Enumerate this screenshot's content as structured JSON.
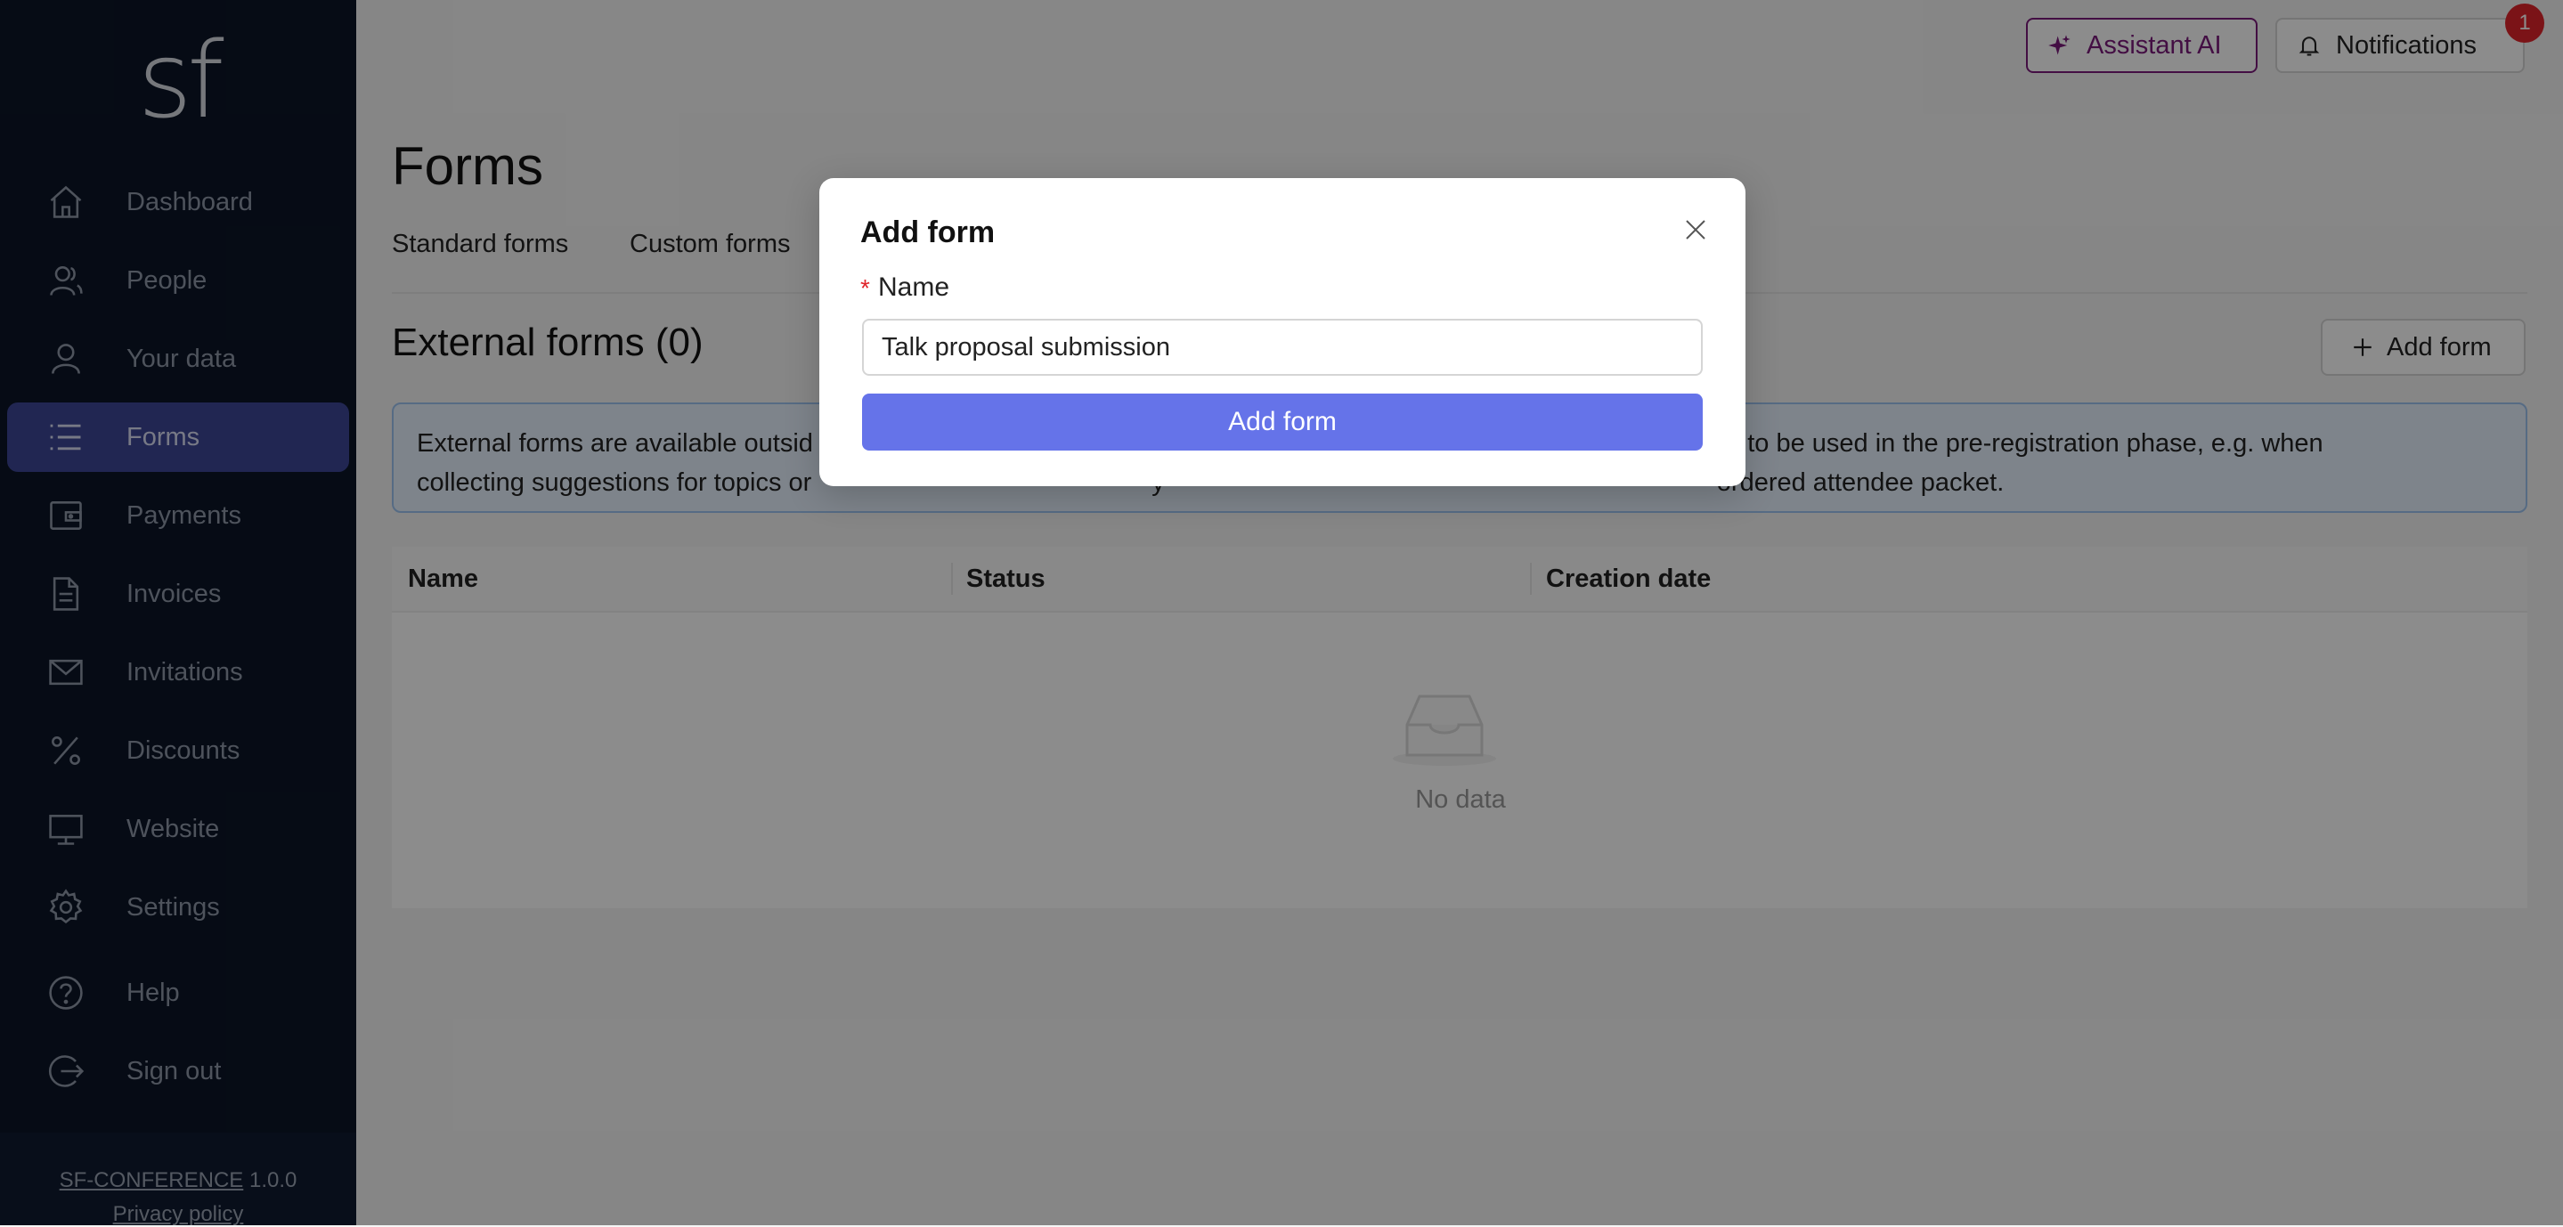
{
  "sidebar": {
    "logo": "sf",
    "items": [
      {
        "label": "Dashboard",
        "icon": "home-icon",
        "active": false
      },
      {
        "label": "People",
        "icon": "people-icon",
        "active": false
      },
      {
        "label": "Your data",
        "icon": "user-icon",
        "active": false
      },
      {
        "label": "Forms",
        "icon": "list-icon",
        "active": true
      },
      {
        "label": "Payments",
        "icon": "wallet-icon",
        "active": false
      },
      {
        "label": "Invoices",
        "icon": "document-icon",
        "active": false
      },
      {
        "label": "Invitations",
        "icon": "mail-icon",
        "active": false
      },
      {
        "label": "Discounts",
        "icon": "percent-icon",
        "active": false
      },
      {
        "label": "Website",
        "icon": "desktop-icon",
        "active": false
      },
      {
        "label": "Settings",
        "icon": "gear-icon",
        "active": false
      },
      {
        "label": "Help",
        "icon": "help-icon",
        "active": false
      },
      {
        "label": "Sign out",
        "icon": "logout-icon",
        "active": false
      }
    ],
    "footer": {
      "app_name": "SF-CONFERENCE",
      "version": "1.0.0",
      "privacy": "Privacy policy"
    }
  },
  "header": {
    "assistant_label": "Assistant AI",
    "notifications_label": "Notifications",
    "notifications_count": "1"
  },
  "main": {
    "title": "Forms",
    "tabs": [
      {
        "label": "Standard forms"
      },
      {
        "label": "Custom forms"
      }
    ],
    "section_title": "External forms (0)",
    "add_button": "Add form",
    "info_line1_left": "External forms are available outsid",
    "info_line1_right": "indented to be used in the pre-registration phase, e.g. when",
    "info_line2_left": "collecting suggestions for topics or",
    "info_line2_mid": "y",
    "info_line2_right": "ordered attendee packet.",
    "table": {
      "columns": [
        "Name",
        "Status",
        "Creation date"
      ],
      "rows": [],
      "empty_text": "No data"
    }
  },
  "modal": {
    "title": "Add form",
    "required_mark": "*",
    "field_label": "Name",
    "field_value": "Talk proposal submission",
    "submit_label": "Add form"
  },
  "colors": {
    "sidebar_bg": "#0b1527",
    "active_item_bg": "#3c4695",
    "primary_button": "#6573e9",
    "assistant_accent": "#7a1a7a",
    "badge": "#e0242a"
  }
}
